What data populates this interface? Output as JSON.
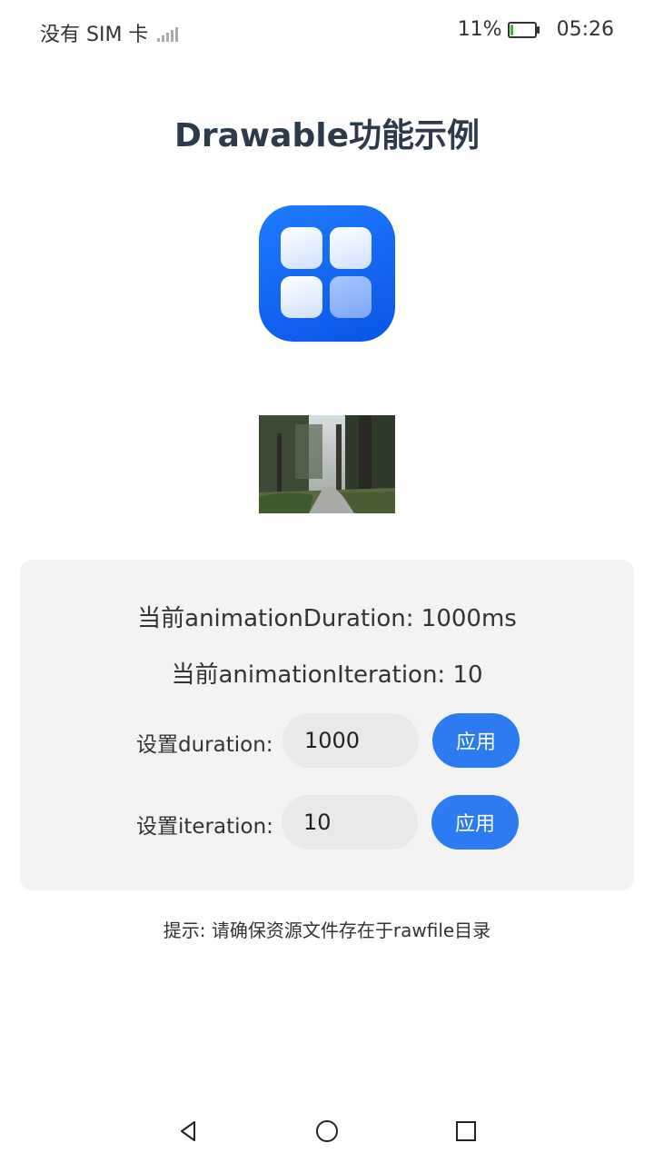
{
  "status_bar": {
    "carrier": "没有 SIM 卡",
    "battery": "11%",
    "time": "05:26",
    "battery_level": 0.11
  },
  "page": {
    "title": "Drawable功能示例"
  },
  "settings": {
    "duration_text": "当前animationDuration: 1000ms",
    "iteration_text": "当前animationIteration: 10",
    "duration_label": "设置duration:",
    "duration_value": "1000",
    "iteration_label": "设置iteration:",
    "iteration_value": "10",
    "apply_label": "应用"
  },
  "hint": "提示: 请确保资源文件存在于rawfile目录",
  "colors": {
    "accent": "#2d7bf0",
    "icon_blue": "#0a55e6",
    "panel_bg": "#f3f3f3"
  },
  "icons": [
    "signal-icon",
    "battery-icon",
    "app-grid-icon",
    "back-icon",
    "home-icon",
    "recents-icon"
  ]
}
